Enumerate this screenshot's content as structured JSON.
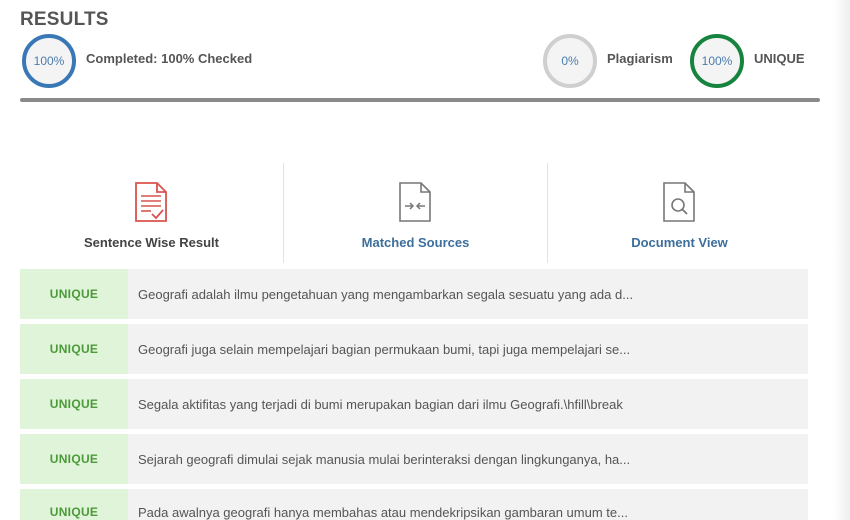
{
  "header": {
    "title": "RESULTS",
    "completed_percent": "100%",
    "completed_label": "Completed: 100% Checked",
    "plagiarism_percent": "0%",
    "plagiarism_label": "Plagiarism",
    "unique_percent": "100%",
    "unique_label": "UNIQUE"
  },
  "colors": {
    "completed_ring": "#3a78b5",
    "plagiarism_ring": "#cfcfcf",
    "unique_ring": "#16843f",
    "unique_badge_bg": "#dff4d8",
    "unique_badge_text": "#4c9a3a"
  },
  "tabs": [
    {
      "label": "Sentence Wise Result",
      "icon": "document-check-icon",
      "active": true
    },
    {
      "label": "Matched Sources",
      "icon": "document-compare-icon",
      "active": false
    },
    {
      "label": "Document View",
      "icon": "document-search-icon",
      "active": false
    }
  ],
  "results": [
    {
      "status": "UNIQUE",
      "text": "Geografi adalah ilmu pengetahuan yang mengambarkan segala sesuatu yang ada d..."
    },
    {
      "status": "UNIQUE",
      "text": "Geografi juga selain mempelajari bagian permukaan bumi, tapi juga mempelajari se..."
    },
    {
      "status": "UNIQUE",
      "text": "Segala aktifitas yang terjadi di bumi merupakan bagian dari ilmu Geografi.\\hfill\\break"
    },
    {
      "status": "UNIQUE",
      "text": "Sejarah geografi dimulai sejak manusia mulai berinteraksi dengan lingkunganya, ha..."
    },
    {
      "status": "UNIQUE",
      "text": "Pada awalnya geografi hanya membahas atau mendekripsikan gambaran umum te..."
    }
  ]
}
